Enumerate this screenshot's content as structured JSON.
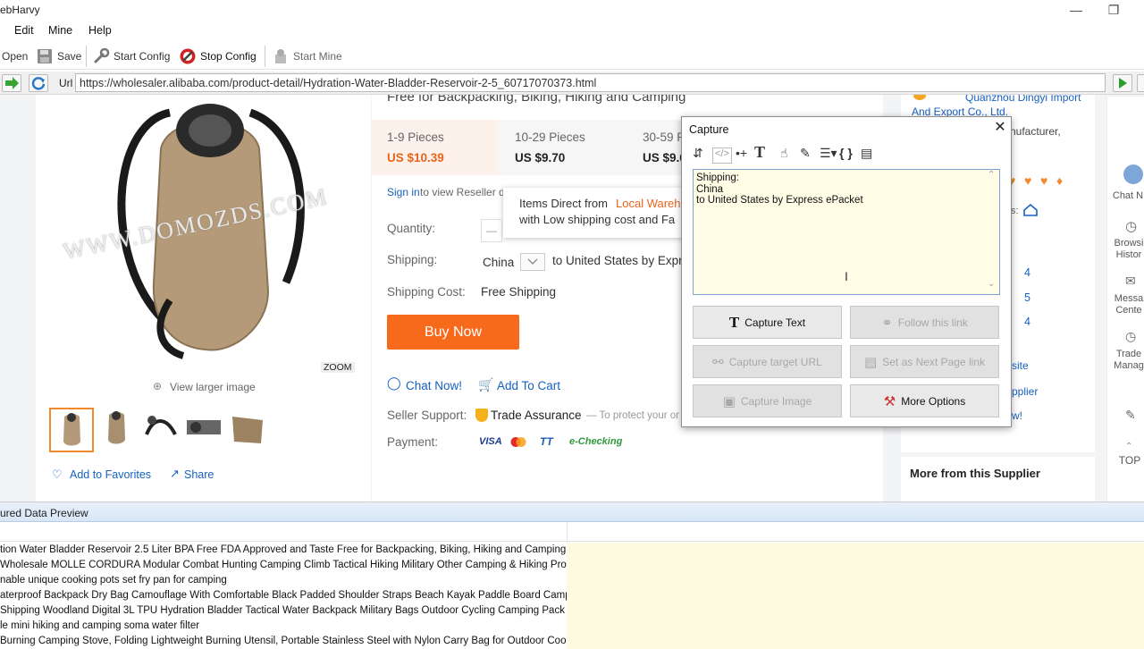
{
  "window": {
    "title": "ebHarvy"
  },
  "menu": {
    "items": [
      "Edit",
      "Mine",
      "Help"
    ]
  },
  "toolbar": {
    "open": "Open",
    "save": "Save",
    "start_config": "Start Config",
    "stop_config": "Stop Config",
    "start_mine": "Start Mine"
  },
  "urlbar": {
    "label": "Url",
    "value": "https://wholesaler.alibaba.com/product-detail/Hydration-Water-Bladder-Reservoir-2-5_60717070373.html"
  },
  "product": {
    "subtitle": "Free for Backpacking, Biking, Hiking and Camping",
    "watermark": "WWW.DOMOZDS.COM",
    "zoom": "ZOOM",
    "view_larger": "View larger image",
    "add_favorites": "Add to Favorites",
    "share": "Share",
    "tiers": [
      {
        "range": "1-9 Pieces",
        "price": "US $10.39"
      },
      {
        "range": "10-29 Pieces",
        "price": "US $9.70"
      },
      {
        "range": "30-59 P",
        "price": "US $9.6"
      }
    ],
    "sign_in": "Sign in",
    "sign_in_rest": "to view Reseller d",
    "tooltip_line1_a": "Items Direct from ",
    "tooltip_line1_b": "Local Wareh",
    "tooltip_line2": "with Low shipping cost and Fa",
    "quantity_label": "Quantity:",
    "quantity_minus": "—",
    "shipping_label": "Shipping:",
    "shipping_from": "China",
    "shipping_to": "to United States by Expr",
    "shipping_cost_label": "Shipping Cost:",
    "shipping_cost": "Free Shipping",
    "buy_now": "Buy Now",
    "chat_now": "Chat Now!",
    "add_to_cart": "Add To Cart",
    "seller_support_label": "Seller Support:",
    "trade_assurance": "Trade Assurance",
    "trade_assurance_note": "— To protect your or",
    "payment_label": "Payment:",
    "payment_methods": [
      "VISA",
      "TT",
      "e-Checking"
    ]
  },
  "supplier": {
    "name_line1": "Quanzhou Dingyi Import",
    "name_line2": "And Export Co., Ltd.",
    "type": "nufacturer,",
    "rating_icons": [
      "heart-icon",
      "heart-icon",
      "heart-icon",
      "heart-icon"
    ],
    "s_label": "s:",
    "stats": [
      "4",
      "5",
      "4"
    ],
    "link1": "site",
    "link2": "pplier",
    "link3": "w!",
    "more_from": "More from this Supplier"
  },
  "right_sidebar": {
    "items": [
      "Chat N",
      "Browsi Histor",
      "Messa Cente",
      "Trade Manag"
    ],
    "top": "TOP"
  },
  "capture": {
    "title": "Capture",
    "text_lines": [
      "Shipping:",
      "China",
      "to United States by Express ePacket"
    ],
    "buttons": {
      "capture_text": "Capture Text",
      "follow_link": "Follow this link",
      "capture_target_url": "Capture target URL",
      "set_next_page": "Set as Next Page link",
      "capture_image": "Capture Image",
      "more_options": "More Options"
    }
  },
  "preview": {
    "title": "ured Data Preview",
    "rows": [
      "tion Water Bladder Reservoir 2.5 Liter BPA Free FDA Approved and Taste Free for Backpacking, Biking, Hiking and Camping",
      "Wholesale MOLLE CORDURA Modular Combat Hunting Camping Climb Tactical Hiking Military Other Camping & Hiking Products",
      "nable unique cooking pots set fry pan for camping",
      "aterproof Backpack Dry Bag Camouflage With Comfortable Black Padded Shoulder Straps Beach Kayak Paddle Board Camping",
      "Shipping Woodland Digital 3L TPU Hydration Bladder Tactical Water Backpack Military Bags Outdoor Cycling Camping Pack",
      "le mini hiking and camping soma water filter",
      "Burning Camping Stove, Folding Lightweight Burning Utensil, Portable Stainless Steel with Nylon Carry Bag for Outdoor Cooki"
    ]
  },
  "colors": {
    "accent": "#f76a1c",
    "link": "#1661c0",
    "capture_bg": "#fffde6",
    "preview_row": "#fffbe0"
  }
}
